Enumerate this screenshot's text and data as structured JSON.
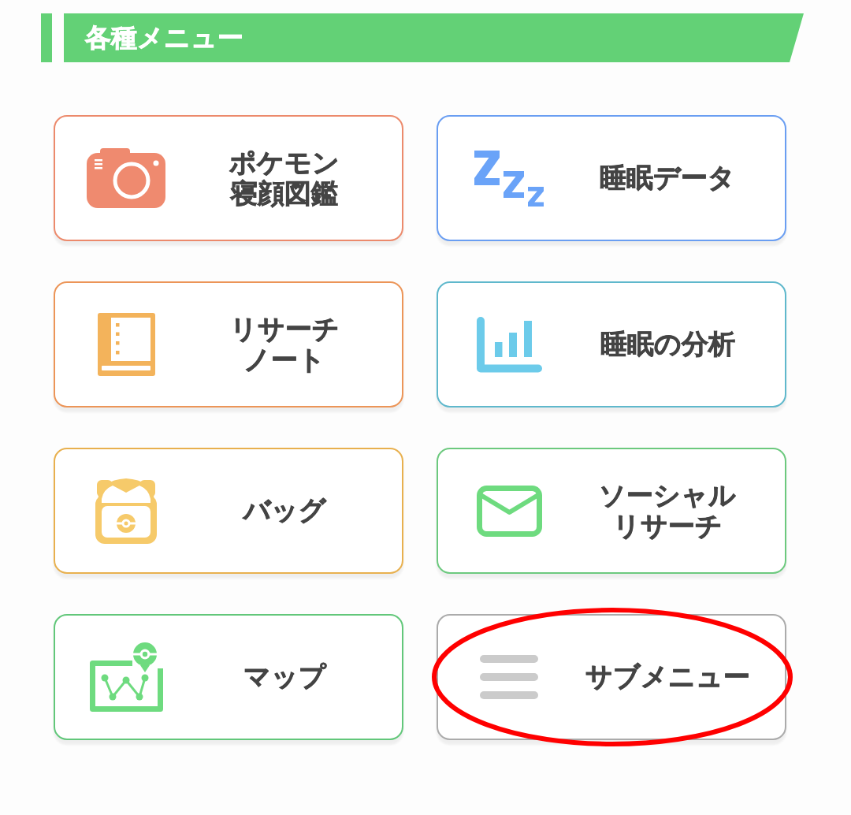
{
  "section_header": {
    "title": "各種メニュー"
  },
  "menu": {
    "items": [
      {
        "kind": "camera",
        "lines": [
          "ポケモン",
          "寝顔図鑑"
        ],
        "color": "#ec8a6c",
        "icon": {
          "color": "#ef8a6f"
        },
        "circled": false
      },
      {
        "kind": "sleep",
        "lines": [
          "睡眠データ"
        ],
        "color": "#6a9ef2",
        "icon": {
          "color": "#6aa3f8"
        },
        "circled": false
      },
      {
        "kind": "notebook",
        "lines": [
          "リサーチ",
          "ノート"
        ],
        "color": "#ec9558",
        "icon": {
          "color": "#f3b35b"
        },
        "circled": false
      },
      {
        "kind": "chart",
        "lines": [
          "睡眠の分析"
        ],
        "color": "#5fb8cc",
        "icon": {
          "color": "#6ccbea"
        },
        "circled": false
      },
      {
        "kind": "bag",
        "lines": [
          "バッグ"
        ],
        "color": "#e8b04e",
        "icon": {
          "color": "#f6ca6a"
        },
        "circled": false
      },
      {
        "kind": "mail",
        "lines": [
          "ソーシャル",
          "リサーチ"
        ],
        "color": "#6cc97e",
        "icon": {
          "color": "#6edb7f"
        },
        "circled": false
      },
      {
        "kind": "map",
        "lines": [
          "マップ"
        ],
        "color": "#62c77a",
        "icon": {
          "color": "#6edb7f"
        },
        "circled": false
      },
      {
        "kind": "menu",
        "lines": [
          "サブメニュー"
        ],
        "color": "#ababab",
        "icon": {
          "color": "#cbcbcb"
        },
        "circled": true
      }
    ]
  }
}
